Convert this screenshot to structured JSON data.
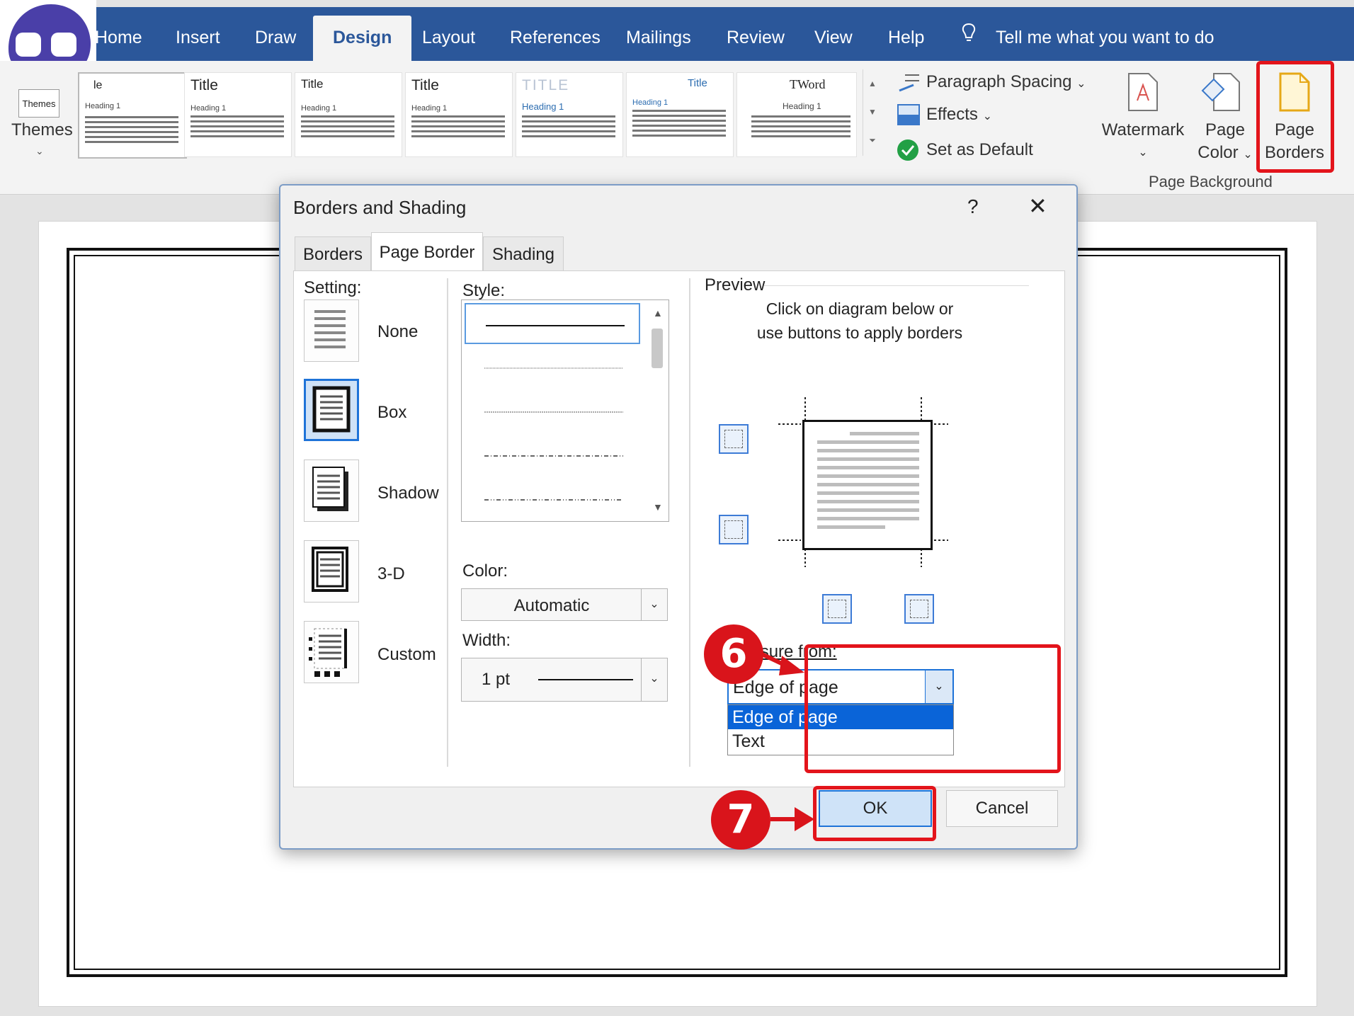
{
  "ribbon": {
    "tabs": [
      "Home",
      "Insert",
      "Draw",
      "Design",
      "Layout",
      "References",
      "Mailings",
      "Review",
      "View",
      "Help"
    ],
    "active_tab": "Design",
    "tell_me": "Tell me what you want to do",
    "themes_label": "Themes",
    "themes_thumb_text": "Themes",
    "style_gallery": [
      {
        "title": "le",
        "heading": "Heading 1"
      },
      {
        "title": "Title",
        "heading": "Heading 1"
      },
      {
        "title": "Title",
        "heading": "Heading 1"
      },
      {
        "title": "Title",
        "heading": "Heading 1"
      },
      {
        "title": "TITLE",
        "heading": "Heading 1"
      },
      {
        "title": "Title",
        "heading": "Heading 1"
      },
      {
        "title": "TWord",
        "heading": "Heading 1"
      }
    ],
    "paragraph_spacing": "Paragraph Spacing",
    "effects": "Effects",
    "set_as_default": "Set as Default",
    "watermark": "Watermark",
    "page_color_1": "Page",
    "page_color_2": "Color",
    "page_borders_1": "Page",
    "page_borders_2": "Borders",
    "group_page_background": "Page Background",
    "accent_color": "#2b579a",
    "highlight_color": "#e3141b"
  },
  "dialog": {
    "title": "Borders and Shading",
    "help": "?",
    "tabs": [
      "Borders",
      "Page Border",
      "Shading"
    ],
    "active_tab": "Page Border",
    "setting_label": "Setting:",
    "settings": [
      "None",
      "Box",
      "Shadow",
      "3-D",
      "Custom"
    ],
    "selected_setting": "Box",
    "style_label": "Style:",
    "color_label": "Color:",
    "color_value": "Automatic",
    "width_label": "Width:",
    "width_value": "1 pt",
    "preview_label": "Preview",
    "preview_hint_1": "Click on diagram below or",
    "preview_hint_2": "use buttons to apply borders",
    "measure_from_label": "Measure from:",
    "measure_from_value": "Edge of page",
    "measure_options": [
      "Edge of page",
      "Text"
    ],
    "ok": "OK",
    "cancel": "Cancel"
  },
  "annotations": {
    "step6": "6",
    "step7": "7"
  }
}
